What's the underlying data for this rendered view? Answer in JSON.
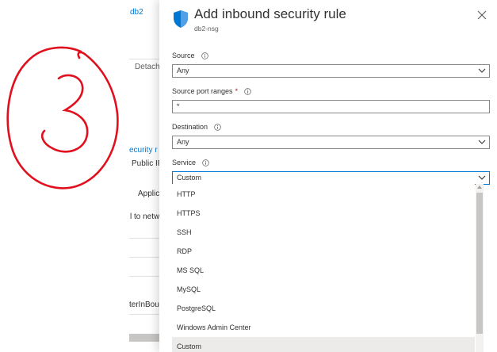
{
  "background": {
    "resource_link": "db2",
    "detach": "Detach",
    "security_link": "ecurity r",
    "public_ip": "Public IP",
    "application": "Applic",
    "network_text": "l to netw",
    "rule_text": "terInBou..."
  },
  "panel": {
    "title": "Add inbound security rule",
    "subtitle": "db2-nsg",
    "fields": {
      "source": {
        "label": "Source",
        "value": "Any"
      },
      "source_ports": {
        "label": "Source port ranges",
        "required": "*",
        "value": "*"
      },
      "destination": {
        "label": "Destination",
        "value": "Any"
      },
      "service": {
        "label": "Service",
        "value": "Custom"
      }
    },
    "service_options": [
      "HTTP",
      "HTTPS",
      "SSH",
      "RDP",
      "MS SQL",
      "MySQL",
      "PostgreSQL",
      "Windows Admin Center",
      "Custom"
    ],
    "selected_option": "Custom"
  },
  "colors": {
    "accent": "#0078d4",
    "annotation": "#e0101e",
    "selected_bg": "#edebe9"
  },
  "icons": {
    "panel_icon": "shield-icon",
    "close": "close-icon",
    "info": "info-icon",
    "dropdown": "chevron-down-icon"
  }
}
